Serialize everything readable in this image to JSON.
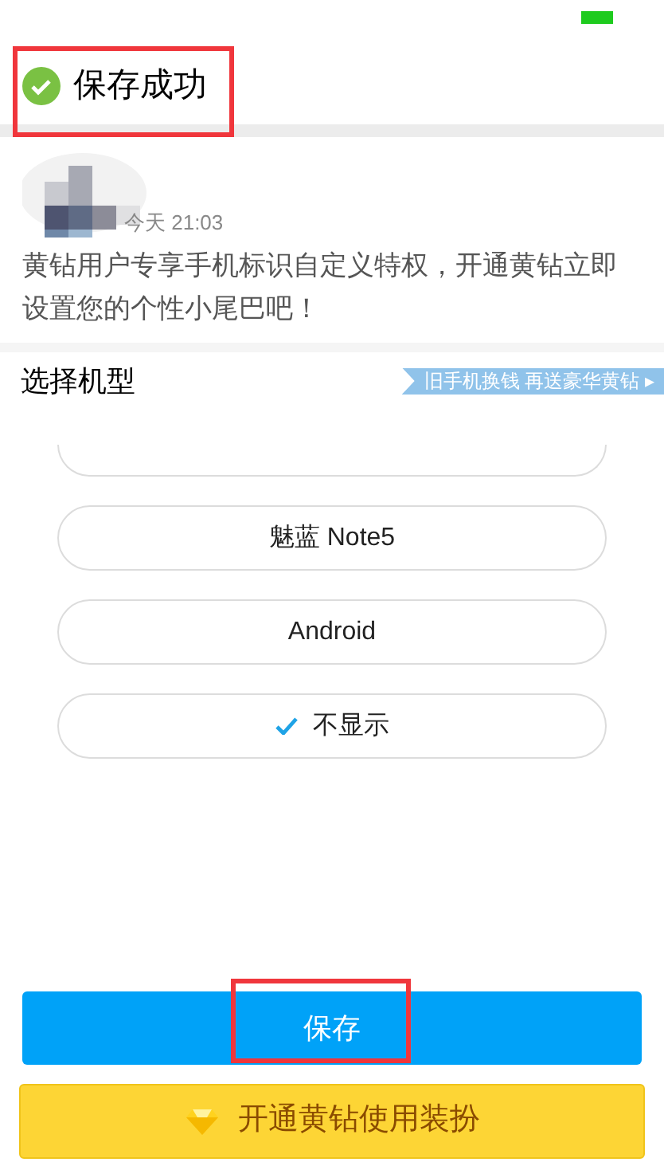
{
  "toast": {
    "text": "保存成功",
    "highlighted": true
  },
  "post": {
    "time": "今天 21:03",
    "text": "黄钻用户专享手机标识自定义特权，开通黄钻立即设置您的个性小尾巴吧！"
  },
  "section": {
    "title": "选择机型",
    "banner": "旧手机换钱 再送豪华黄钻 ▸"
  },
  "options": [
    {
      "label": "魅蓝 Note5",
      "selected": false
    },
    {
      "label": "Android",
      "selected": false
    },
    {
      "label": "不显示",
      "selected": true
    }
  ],
  "save_button": {
    "label": "保存",
    "highlighted": true
  },
  "vip_button": {
    "label": "开通黄钻使用装扮"
  }
}
